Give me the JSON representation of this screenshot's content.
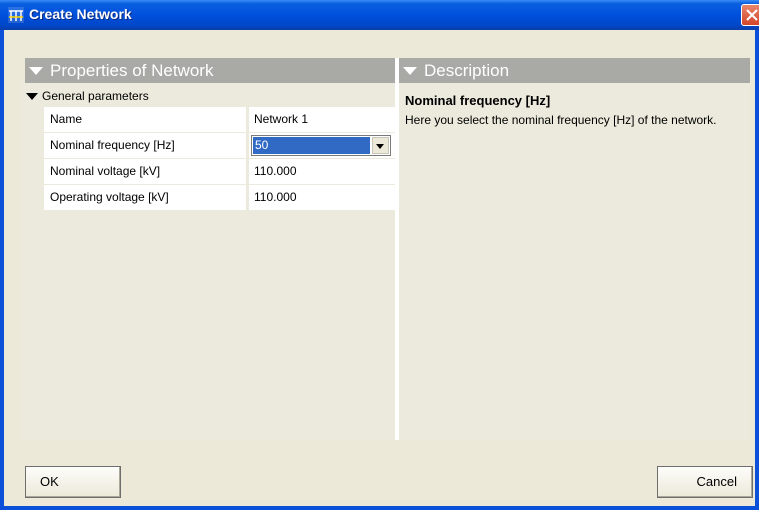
{
  "window": {
    "title": "Create Network"
  },
  "properties": {
    "header": "Properties of Network",
    "group": "General parameters",
    "rows": [
      {
        "name": "Name",
        "value": "Network 1"
      },
      {
        "name": "Nominal frequency [Hz]",
        "value": "50"
      },
      {
        "name": "Nominal voltage [kV]",
        "value": "110.000"
      },
      {
        "name": "Operating voltage [kV]",
        "value": "110.000"
      }
    ]
  },
  "description": {
    "header": "Description",
    "title": "Nominal frequency [Hz]",
    "text": "Here you select the nominal frequency [Hz] of the network."
  },
  "buttons": {
    "ok": "OK",
    "cancel": "Cancel"
  },
  "icons": {
    "title": "network-icon",
    "close": "close-icon"
  },
  "colors": {
    "titlebar": "#0050dc",
    "section_header": "#a9a9a6",
    "selection": "#316ac5"
  }
}
